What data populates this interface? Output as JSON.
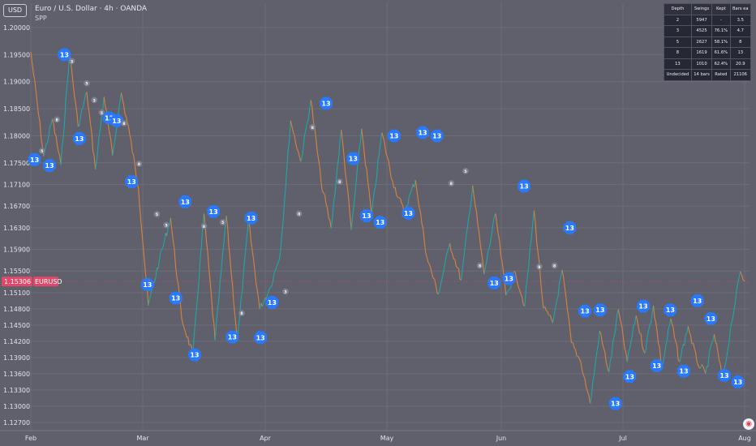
{
  "header": {
    "currency": "USD",
    "title": "Euro / U.S. Dollar · 4h · OANDA",
    "subtitle": "SPP"
  },
  "stats_table": {
    "columns": [
      "Depth",
      "Swings",
      "Kept",
      "Bars ea"
    ],
    "rows": [
      [
        "2",
        "5947",
        "-",
        "3.5"
      ],
      [
        "3",
        "4525",
        "76.1%",
        "4.7"
      ],
      [
        "5",
        "2627",
        "58.1%",
        "8"
      ],
      [
        "8",
        "1619",
        "61.6%",
        "13"
      ],
      [
        "13",
        "1010",
        "62.4%",
        "20.9"
      ],
      [
        "Undecided",
        "14 bars",
        "Rated",
        "21106"
      ]
    ]
  },
  "price_tag": {
    "value": "1.15306",
    "symbol": "EURUSD",
    "price": 1.15306,
    "color": "#e0486a"
  },
  "colors": {
    "background": "#5f606c",
    "grid": "#6c6d79",
    "line_teal": "#1fa7a7",
    "line_orange": "#d9823a",
    "marker_blue": "#2979ff",
    "marker_gray": "#7d808e"
  },
  "chart_data": {
    "type": "line",
    "series": [
      {
        "name": "",
        "x": [
          "Feb",
          "Feb",
          "Feb",
          "Feb",
          "Feb",
          "Feb",
          "Feb",
          "Feb",
          "Feb",
          "Feb",
          "Feb",
          "Feb",
          "Feb",
          "Mar",
          "Mar",
          "Mar",
          "Mar",
          "Mar",
          "Mar",
          "Mar",
          "Mar",
          "Mar",
          "Mar",
          "Mar",
          "Apr",
          "Apr",
          "Apr",
          "Apr",
          "Apr",
          "Apr",
          "Apr",
          "Apr",
          "Apr",
          "Apr",
          "Apr",
          "Apr",
          "May",
          "May",
          "May",
          "May",
          "May",
          "May",
          "May",
          "May",
          "May",
          "May",
          "Jun",
          "Jun",
          "Jun",
          "Jun",
          "Jun",
          "Jun",
          "Jun",
          "Jun",
          "Jun",
          "Jun",
          "Jun",
          "Jun",
          "Jun",
          "Jul",
          "Jul",
          "Jul",
          "Jul",
          "Jul",
          "Jul",
          "Jul",
          "Jul",
          "Jul",
          "Jul",
          "Jul",
          "Jul",
          "Jul",
          "Jul",
          "Aug"
        ],
        "y": [
          1.1955,
          1.1762,
          1.1831,
          1.1746,
          1.1953,
          1.1817,
          1.1881,
          1.1738,
          1.1872,
          1.1763,
          1.1879,
          1.1801,
          1.1703,
          1.1486,
          1.1571,
          1.1648,
          1.1462,
          1.1395,
          1.1656,
          1.1422,
          1.1652,
          1.142,
          1.1642,
          1.148,
          1.152,
          1.1585,
          1.1828,
          1.1752,
          1.1866,
          1.1716,
          1.1629,
          1.1811,
          1.1626,
          1.1813,
          1.1653,
          1.1806,
          1.1716,
          1.1659,
          1.1718,
          1.1575,
          1.1507,
          1.1601,
          1.1533,
          1.1708,
          1.1544,
          1.1656,
          1.1505,
          1.1548,
          1.1485,
          1.1662,
          1.1481,
          1.1454,
          1.1552,
          1.1417,
          1.1382,
          1.1305,
          1.1439,
          1.1363,
          1.1479,
          1.1382,
          1.1468,
          1.1398,
          1.1486,
          1.1371,
          1.1462,
          1.1382,
          1.1448,
          1.1383,
          1.136,
          1.1433,
          1.1347,
          1.1455,
          1.1549,
          1.1531
        ],
        "color": "#1fa7a7"
      }
    ],
    "swing_markers": [
      {
        "x": "Feb",
        "y": 1.1756,
        "label": "13",
        "kind": "blue"
      },
      {
        "x": "Feb",
        "y": 1.1772,
        "label": "5",
        "kind": "gray"
      },
      {
        "x": "Feb",
        "y": 1.1745,
        "label": "13",
        "kind": "blue"
      },
      {
        "x": "Feb",
        "y": 1.183,
        "label": "8",
        "kind": "gray"
      },
      {
        "x": "Feb",
        "y": 1.195,
        "label": "13",
        "kind": "blue"
      },
      {
        "x": "Feb",
        "y": 1.1938,
        "label": "3",
        "kind": "gray"
      },
      {
        "x": "Feb",
        "y": 1.1795,
        "label": "13",
        "kind": "blue"
      },
      {
        "x": "Feb",
        "y": 1.1897,
        "label": "5",
        "kind": "gray"
      },
      {
        "x": "Feb",
        "y": 1.1866,
        "label": "3",
        "kind": "gray"
      },
      {
        "x": "Feb",
        "y": 1.1843,
        "label": "5",
        "kind": "gray"
      },
      {
        "x": "Feb",
        "y": 1.1833,
        "label": "13",
        "kind": "blue"
      },
      {
        "x": "Feb",
        "y": 1.1828,
        "label": "13",
        "kind": "blue"
      },
      {
        "x": "Feb",
        "y": 1.1823,
        "label": "8",
        "kind": "gray"
      },
      {
        "x": "Feb",
        "y": 1.1715,
        "label": "13",
        "kind": "blue"
      },
      {
        "x": "Feb",
        "y": 1.1748,
        "label": "8",
        "kind": "gray"
      },
      {
        "x": "Mar",
        "y": 1.1525,
        "label": "13",
        "kind": "blue"
      },
      {
        "x": "Mar",
        "y": 1.1655,
        "label": "5",
        "kind": "gray"
      },
      {
        "x": "Mar",
        "y": 1.1635,
        "label": "5",
        "kind": "gray"
      },
      {
        "x": "Mar",
        "y": 1.15,
        "label": "13",
        "kind": "blue"
      },
      {
        "x": "Mar",
        "y": 1.1678,
        "label": "13",
        "kind": "blue"
      },
      {
        "x": "Mar",
        "y": 1.1395,
        "label": "13",
        "kind": "blue"
      },
      {
        "x": "Mar",
        "y": 1.1633,
        "label": "8",
        "kind": "gray"
      },
      {
        "x": "Mar",
        "y": 1.166,
        "label": "13",
        "kind": "blue"
      },
      {
        "x": "Mar",
        "y": 1.164,
        "label": "5",
        "kind": "gray"
      },
      {
        "x": "Mar",
        "y": 1.1428,
        "label": "13",
        "kind": "blue"
      },
      {
        "x": "Mar",
        "y": 1.1472,
        "label": "8",
        "kind": "gray"
      },
      {
        "x": "Mar",
        "y": 1.1648,
        "label": "13",
        "kind": "blue"
      },
      {
        "x": "Mar",
        "y": 1.1427,
        "label": "13",
        "kind": "blue"
      },
      {
        "x": "Apr",
        "y": 1.1492,
        "label": "13",
        "kind": "blue"
      },
      {
        "x": "Apr",
        "y": 1.1512,
        "label": "3",
        "kind": "gray"
      },
      {
        "x": "Apr",
        "y": 1.1656,
        "label": "8",
        "kind": "gray"
      },
      {
        "x": "Apr",
        "y": 1.1816,
        "label": "8",
        "kind": "gray"
      },
      {
        "x": "Apr",
        "y": 1.186,
        "label": "13",
        "kind": "blue"
      },
      {
        "x": "Apr",
        "y": 1.1715,
        "label": "8",
        "kind": "gray"
      },
      {
        "x": "Apr",
        "y": 1.1758,
        "label": "13",
        "kind": "blue"
      },
      {
        "x": "Apr",
        "y": 1.1652,
        "label": "13",
        "kind": "blue"
      },
      {
        "x": "Apr",
        "y": 1.164,
        "label": "13",
        "kind": "blue"
      },
      {
        "x": "May",
        "y": 1.18,
        "label": "13",
        "kind": "blue"
      },
      {
        "x": "May",
        "y": 1.1657,
        "label": "13",
        "kind": "blue"
      },
      {
        "x": "May",
        "y": 1.1806,
        "label": "13",
        "kind": "blue"
      },
      {
        "x": "May",
        "y": 1.18,
        "label": "13",
        "kind": "blue"
      },
      {
        "x": "May",
        "y": 1.1712,
        "label": "8",
        "kind": "gray"
      },
      {
        "x": "May",
        "y": 1.1735,
        "label": "5",
        "kind": "gray"
      },
      {
        "x": "May",
        "y": 1.156,
        "label": "8",
        "kind": "gray"
      },
      {
        "x": "May",
        "y": 1.1528,
        "label": "13",
        "kind": "blue"
      },
      {
        "x": "Jun",
        "y": 1.1536,
        "label": "13",
        "kind": "blue"
      },
      {
        "x": "Jun",
        "y": 1.1707,
        "label": "13",
        "kind": "blue"
      },
      {
        "x": "Jun",
        "y": 1.1558,
        "label": "8",
        "kind": "gray"
      },
      {
        "x": "Jun",
        "y": 1.156,
        "label": "8",
        "kind": "gray"
      },
      {
        "x": "Jun",
        "y": 1.163,
        "label": "13",
        "kind": "blue"
      },
      {
        "x": "Jun",
        "y": 1.1476,
        "label": "13",
        "kind": "blue"
      },
      {
        "x": "Jun",
        "y": 1.1478,
        "label": "13",
        "kind": "blue"
      },
      {
        "x": "Jun",
        "y": 1.1305,
        "label": "13",
        "kind": "blue"
      },
      {
        "x": "Jul",
        "y": 1.1355,
        "label": "13",
        "kind": "blue"
      },
      {
        "x": "Jul",
        "y": 1.1485,
        "label": "13",
        "kind": "blue"
      },
      {
        "x": "Jul",
        "y": 1.1375,
        "label": "13",
        "kind": "blue"
      },
      {
        "x": "Jul",
        "y": 1.1478,
        "label": "13",
        "kind": "blue"
      },
      {
        "x": "Jul",
        "y": 1.1365,
        "label": "13",
        "kind": "blue"
      },
      {
        "x": "Jul",
        "y": 1.1495,
        "label": "13",
        "kind": "blue"
      },
      {
        "x": "Jul",
        "y": 1.1462,
        "label": "13",
        "kind": "blue"
      },
      {
        "x": "Jul",
        "y": 1.1357,
        "label": "13",
        "kind": "blue"
      },
      {
        "x": "Jul",
        "y": 1.1345,
        "label": "13",
        "kind": "blue"
      }
    ],
    "y_ticks": [
      "1.20000",
      "1.19500",
      "1.19000",
      "1.18500",
      "1.18000",
      "1.17500",
      "1.17100",
      "1.16700",
      "1.16300",
      "1.15900",
      "1.15500",
      "1.15100",
      "1.14800",
      "1.14500",
      "1.14200",
      "1.13900",
      "1.13600",
      "1.13300",
      "1.13000",
      "1.12700"
    ],
    "x_ticks": [
      "Feb",
      "Mar",
      "Apr",
      "May",
      "Jun",
      "Jul",
      "Aug"
    ],
    "ylim": [
      1.1255,
      1.2045
    ],
    "grid": true,
    "title": "Euro / U.S. Dollar · 4h · OANDA",
    "xlabel": "",
    "ylabel": ""
  }
}
